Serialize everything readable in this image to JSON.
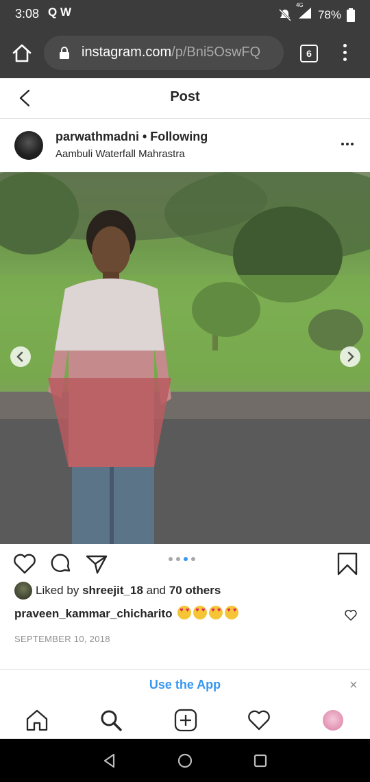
{
  "status_bar": {
    "time": "3:08",
    "left_icons": "Q W",
    "network": "4G",
    "battery": "78%"
  },
  "browser": {
    "url_host": "instagram.com",
    "url_path": "/p/Bni5OswFQ",
    "tab_count": "6"
  },
  "header": {
    "title": "Post"
  },
  "post": {
    "username": "parwathmadni",
    "follow_status": "• Following",
    "location": "Aambuli Waterfall Mahrastra",
    "carousel": {
      "count": 4,
      "active_index": 2
    }
  },
  "likes": {
    "prefix": "Liked by",
    "user": "shreejit_18",
    "conjunction": "and",
    "others": "70 others"
  },
  "comment": {
    "user": "praveen_kammar_chicharito",
    "emoji_count": 4
  },
  "date": "SEPTEMBER 10, 2018",
  "banner": {
    "label": "Use the App",
    "close": "×"
  },
  "colors": {
    "accent": "#3897f0",
    "chrome": "#3c3c3c",
    "text": "#262626",
    "muted": "#8e8e8e"
  },
  "icons": {
    "nav": [
      "home-icon",
      "search-icon",
      "new-post-icon",
      "activity-heart-icon",
      "profile-avatar"
    ],
    "actions": [
      "like-heart-icon",
      "comment-bubble-icon",
      "share-paper-plane-icon",
      "save-bookmark-icon"
    ]
  }
}
